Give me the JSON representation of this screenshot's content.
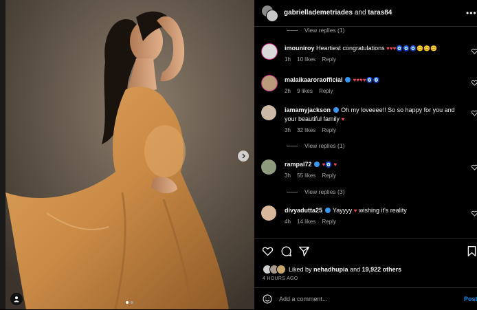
{
  "header": {
    "username": "gabrielladem​etriades",
    "joiner": "and",
    "collaborator": "taras84",
    "more_label": "•••"
  },
  "comments": [
    {
      "user": "imouniroy",
      "verified": false,
      "text": "Heartiest congratulations",
      "emoji": "♥♥♥🧿🧿🧿😊😊😊",
      "time": "1h",
      "likes": "10 likes",
      "reply": "Reply",
      "avatar_color": "#d9d9d9"
    },
    {
      "user": "malaikaaroraofficial",
      "verified": true,
      "text": "",
      "emoji": "♥♥♥♥🧿🧿",
      "time": "2h",
      "likes": "9 likes",
      "reply": "Reply",
      "avatar_color": "#b89a7a"
    },
    {
      "user": "iamamyjackson",
      "verified": true,
      "text": "Oh my loveeee!! So so happy for you and your beautiful family",
      "emoji": "♥",
      "time": "3h",
      "likes": "32 likes",
      "reply": "Reply",
      "avatar_color": "#cbb9a6"
    },
    {
      "user": "rampal72",
      "verified": true,
      "text": "",
      "emoji": "♥🧿 ♥",
      "time": "3h",
      "likes": "55 likes",
      "reply": "Reply",
      "avatar_color": "#8d9a7c"
    },
    {
      "user": "divyadutta25",
      "verified": true,
      "text": "Yayyyy",
      "emoji": "♥",
      "text2": "wishing it's reality",
      "time": "4h",
      "likes": "14 likes",
      "reply": "Reply",
      "avatar_color": "#d8b79a"
    }
  ],
  "view_replies": [
    "View replies (1)",
    "View replies (1)",
    "View replies (3)"
  ],
  "likes": {
    "prefix": "Liked by",
    "user": "nehadhupia",
    "joiner": "and",
    "others": "19,922 others"
  },
  "time_ago": "4 HOURS AGO",
  "add_comment": {
    "placeholder": "Add a comment...",
    "post_label": "Post"
  },
  "colors": {
    "heart": "#ed4956",
    "accent": "#0095f6",
    "dress": "#c98a45"
  },
  "icons": {
    "next": "chevron-right-icon",
    "tag": "user-tag-icon",
    "like": "heart-icon",
    "comment": "comment-bubble-icon",
    "share": "paper-plane-icon",
    "save": "bookmark-icon",
    "emoji": "smiley-icon"
  }
}
